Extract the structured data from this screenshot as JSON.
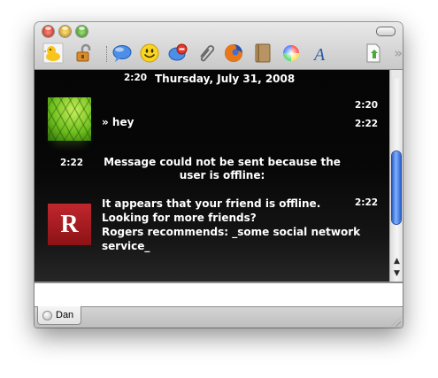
{
  "window": {
    "title": ""
  },
  "toolbar": {
    "items": [
      {
        "icon": "duck-icon"
      },
      {
        "icon": "padlock-icon"
      },
      {
        "icon": "speech-bubble-icon"
      },
      {
        "icon": "smiley-icon"
      },
      {
        "icon": "block-user-icon"
      },
      {
        "icon": "paperclip-icon"
      },
      {
        "icon": "firefox-icon"
      },
      {
        "icon": "address-book-icon"
      },
      {
        "icon": "color-wheel-icon"
      },
      {
        "icon": "font-icon"
      },
      {
        "icon": "document-icon"
      }
    ],
    "overflow": "»"
  },
  "log": {
    "date_time": "2:20",
    "date_label": "Thursday, July 31, 2008",
    "messages": [
      {
        "avatar": "leaf",
        "text": "» hey",
        "time_top": "2:20",
        "time": "2:22"
      }
    ],
    "status": {
      "time": "2:22",
      "text": "Message could not be sent because the user is offline:"
    },
    "auto_reply": {
      "avatar": "Rogers",
      "avatar_letter": "R",
      "line1": "It appears that your friend is offline.",
      "line2": "Looking for more friends?",
      "line3": "Rogers recommends: _some social network",
      "line4": "service_",
      "time": "2:22"
    }
  },
  "input": {
    "value": ""
  },
  "tabs": [
    {
      "label": "Dan"
    }
  ],
  "colors": {
    "log_background": "#000000",
    "log_text": "#ffffff",
    "scroll_thumb": "#4a86e8",
    "rogers_red": "#b0202a"
  }
}
